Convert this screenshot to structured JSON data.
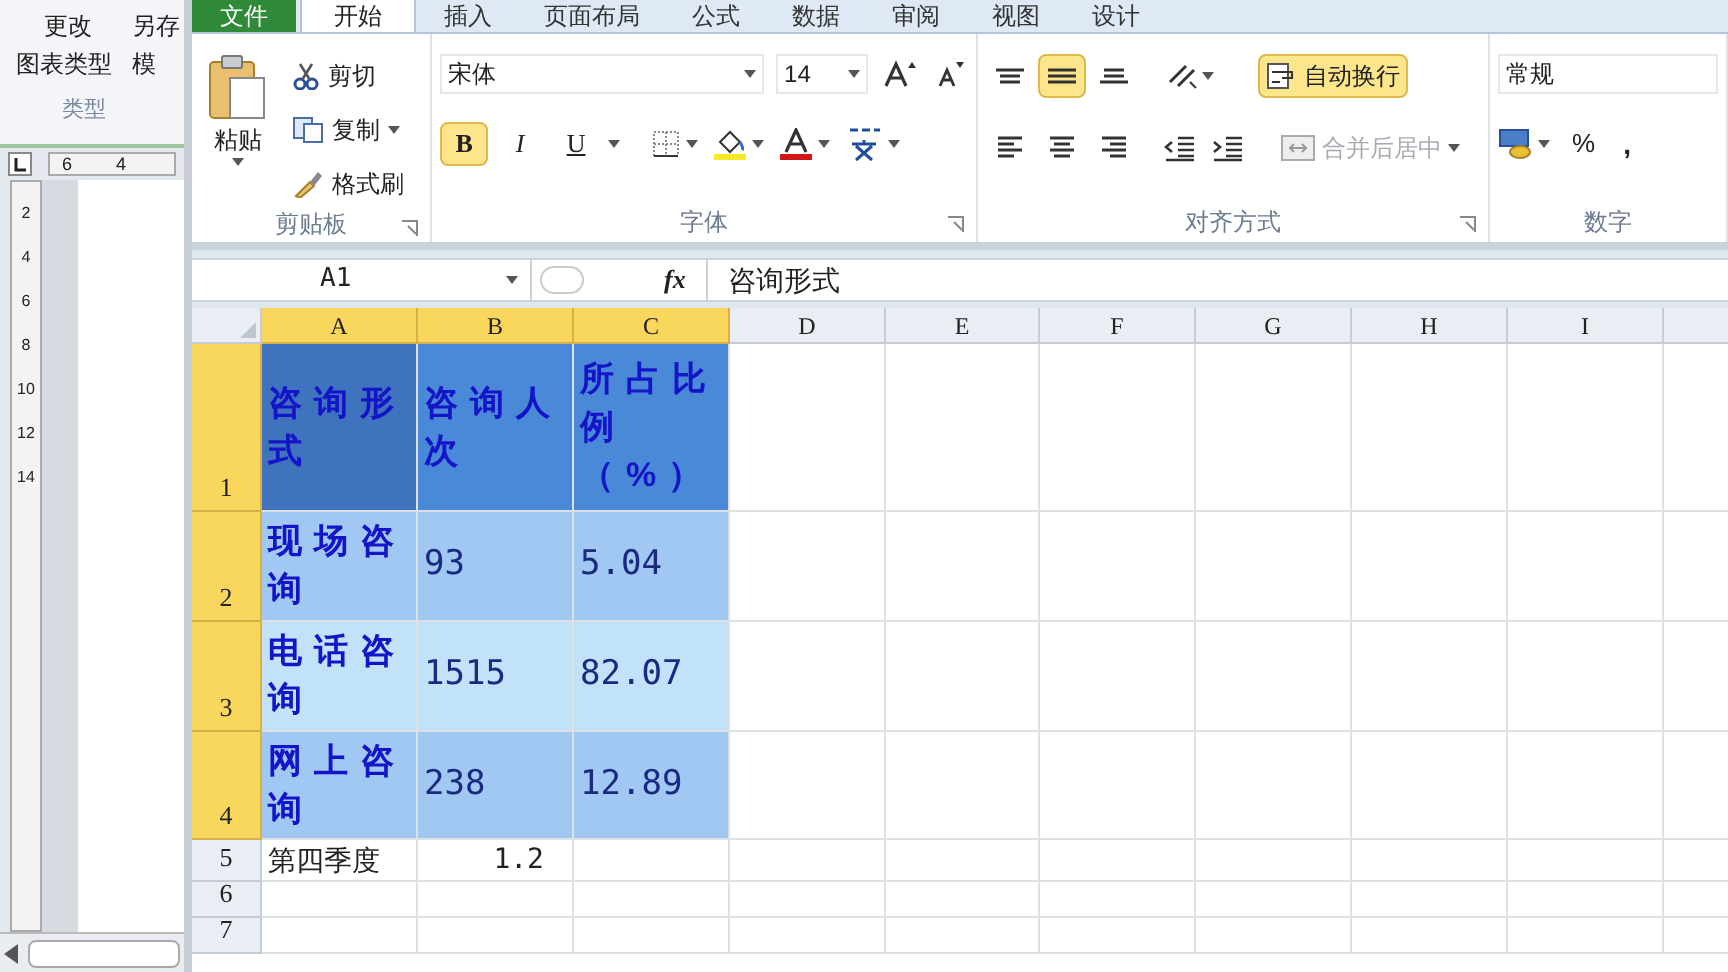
{
  "word_window": {
    "commands": [
      "更改",
      "另存",
      "图表类型",
      "模"
    ],
    "group_label": "类型",
    "ruler_marks": [
      "6",
      "4"
    ],
    "vertical_ruler_marks": [
      "2",
      "4",
      "6",
      "8",
      "10",
      "12",
      "14"
    ]
  },
  "tabs": [
    {
      "label": "文件",
      "selected": false,
      "kind": "file"
    },
    {
      "label": "开始",
      "selected": true,
      "kind": "tab"
    },
    {
      "label": "插入",
      "selected": false,
      "kind": "tab"
    },
    {
      "label": "页面布局",
      "selected": false,
      "kind": "tab"
    },
    {
      "label": "公式",
      "selected": false,
      "kind": "tab"
    },
    {
      "label": "数据",
      "selected": false,
      "kind": "tab"
    },
    {
      "label": "审阅",
      "selected": false,
      "kind": "tab"
    },
    {
      "label": "视图",
      "selected": false,
      "kind": "tab"
    },
    {
      "label": "设计",
      "selected": false,
      "kind": "tab"
    }
  ],
  "clipboard": {
    "paste": "粘贴",
    "cut": "剪切",
    "copy": "复制",
    "format_painter": "格式刷",
    "label": "剪贴板"
  },
  "font": {
    "name": "宋体",
    "size": "14",
    "bold_label": "B",
    "italic_label": "I",
    "underline_label": "U",
    "bold": true,
    "italic": false,
    "underline": false,
    "label": "字体"
  },
  "alignment": {
    "vertical": [
      {
        "selected": false
      },
      {
        "selected": true
      },
      {
        "selected": false
      }
    ],
    "horizontal": [
      {
        "selected": false
      },
      {
        "selected": false
      },
      {
        "selected": false
      }
    ],
    "wrap_text": {
      "label": "自动换行",
      "selected": true
    },
    "merge_center": {
      "label": "合并后居中",
      "disabled": true
    },
    "label": "对齐方式"
  },
  "number": {
    "format": "常规",
    "percent": "%",
    "comma": ",",
    "label": "数字"
  },
  "formula_bar": {
    "name_box": "A1",
    "fx": "fx",
    "content": "咨询形式"
  },
  "columns": [
    {
      "label": "A",
      "selected": true
    },
    {
      "label": "B",
      "selected": true
    },
    {
      "label": "C",
      "selected": true
    },
    {
      "label": "D",
      "selected": false
    },
    {
      "label": "E",
      "selected": false
    },
    {
      "label": "F",
      "selected": false
    },
    {
      "label": "G",
      "selected": false
    },
    {
      "label": "H",
      "selected": false
    },
    {
      "label": "I",
      "selected": false
    }
  ],
  "rows": [
    {
      "header": "1",
      "selected": true,
      "cells": [
        {
          "text": "咨询形式",
          "kind": "title",
          "color": "#3f73bd"
        },
        {
          "text": "咨询人次",
          "kind": "title",
          "color": "#4a88d8"
        },
        {
          "text": "所占比例（%）",
          "kind": "title",
          "color": "#4a88d8"
        }
      ]
    },
    {
      "header": "2",
      "selected": true,
      "cells": [
        {
          "text": "现场咨询",
          "kind": "title",
          "color": "#a0c8f2"
        },
        {
          "text": "93",
          "kind": "value",
          "color": "#a0c8f2"
        },
        {
          "text": "5.04",
          "kind": "value",
          "color": "#a0c8f2"
        }
      ]
    },
    {
      "header": "3",
      "selected": true,
      "cells": [
        {
          "text": "电话咨询",
          "kind": "title",
          "color": "#c2e2fa"
        },
        {
          "text": "1515",
          "kind": "value",
          "color": "#c2e2fa"
        },
        {
          "text": "82.07",
          "kind": "value",
          "color": "#c2e2fa"
        }
      ]
    },
    {
      "header": "4",
      "selected": true,
      "cells": [
        {
          "text": "网上咨询",
          "kind": "title",
          "color": "#a0c8f2"
        },
        {
          "text": "238",
          "kind": "value",
          "color": "#a0c8f2"
        },
        {
          "text": "12.89",
          "kind": "value",
          "color": "#a0c8f2"
        }
      ]
    },
    {
      "header": "5",
      "selected": false,
      "cells": [
        {
          "text": "第四季度",
          "kind": "text"
        },
        {
          "text": "1.2",
          "kind": "number"
        }
      ]
    },
    {
      "header": "6",
      "selected": false,
      "cells": []
    },
    {
      "header": "7",
      "selected": false,
      "cells": []
    }
  ]
}
